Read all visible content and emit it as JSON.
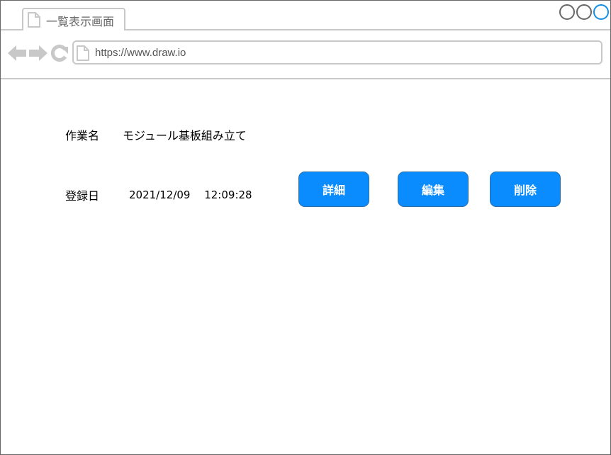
{
  "tab": {
    "title": "一覧表示画面"
  },
  "address": {
    "url": "https://www.draw.io"
  },
  "window_controls": [
    "minimize",
    "maximize",
    "close"
  ],
  "nav": {
    "back": "arrow-left-icon",
    "forward": "arrow-right-icon",
    "reload": "reload-icon"
  },
  "record": {
    "task_label": "作業名",
    "task_value": "モジュール基板組み立て",
    "date_label": "登録日",
    "date_value": "2021/12/09　 12:09:28"
  },
  "actions": {
    "detail": "詳細",
    "edit": "編集",
    "delete": "削除"
  },
  "colors": {
    "button": "#0a8cff",
    "button_border": "#2f6fa8",
    "chrome_line": "#c8c8c8",
    "active_control": "#0f8ee8"
  }
}
